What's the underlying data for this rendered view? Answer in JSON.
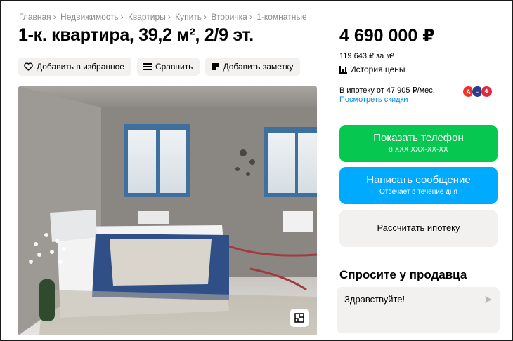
{
  "breadcrumbs": [
    "Главная",
    "Недвижимость",
    "Квартиры",
    "Купить",
    "Вторичка",
    "1-комнатные"
  ],
  "breadcrumb_separator": "›",
  "listing": {
    "title": "1-к. квартира, 39,2 м², 2/9 эт."
  },
  "actions": {
    "favorite_label": "Добавить в избранное",
    "compare_label": "Сравнить",
    "note_label": "Добавить заметку"
  },
  "price": {
    "value": "4 690 000 ₽",
    "per_m2": "119 643 ₽ за м²",
    "history_label": "История цены"
  },
  "mortgage": {
    "text": "В ипотеку от 47 905 ₽/мес.",
    "discounts_link": "Посмотреть скидки",
    "bank_logos": [
      {
        "icon": "alfa-bank-logo",
        "color": "#ef3124",
        "glyph": "А"
      },
      {
        "icon": "bank-logo-blue",
        "color": "#2f3a8f",
        "glyph": "≡"
      },
      {
        "icon": "bank-logo-red",
        "color": "#e02a3d",
        "glyph": "❖"
      }
    ]
  },
  "buttons": {
    "phone_label": "Показать телефон",
    "phone_sub": "8 XXX XXX-XX-XX",
    "message_label": "Написать сообщение",
    "message_sub": "Отвечает в течение дня",
    "calc_label": "Рассчитать ипотеку"
  },
  "ask": {
    "title": "Спросите у продавца",
    "input_value": "Здравствуйте!"
  },
  "colors": {
    "green": "#06c851",
    "blue": "#00aaff",
    "link": "#0a8de1",
    "button_grey": "#f2f1f0"
  }
}
